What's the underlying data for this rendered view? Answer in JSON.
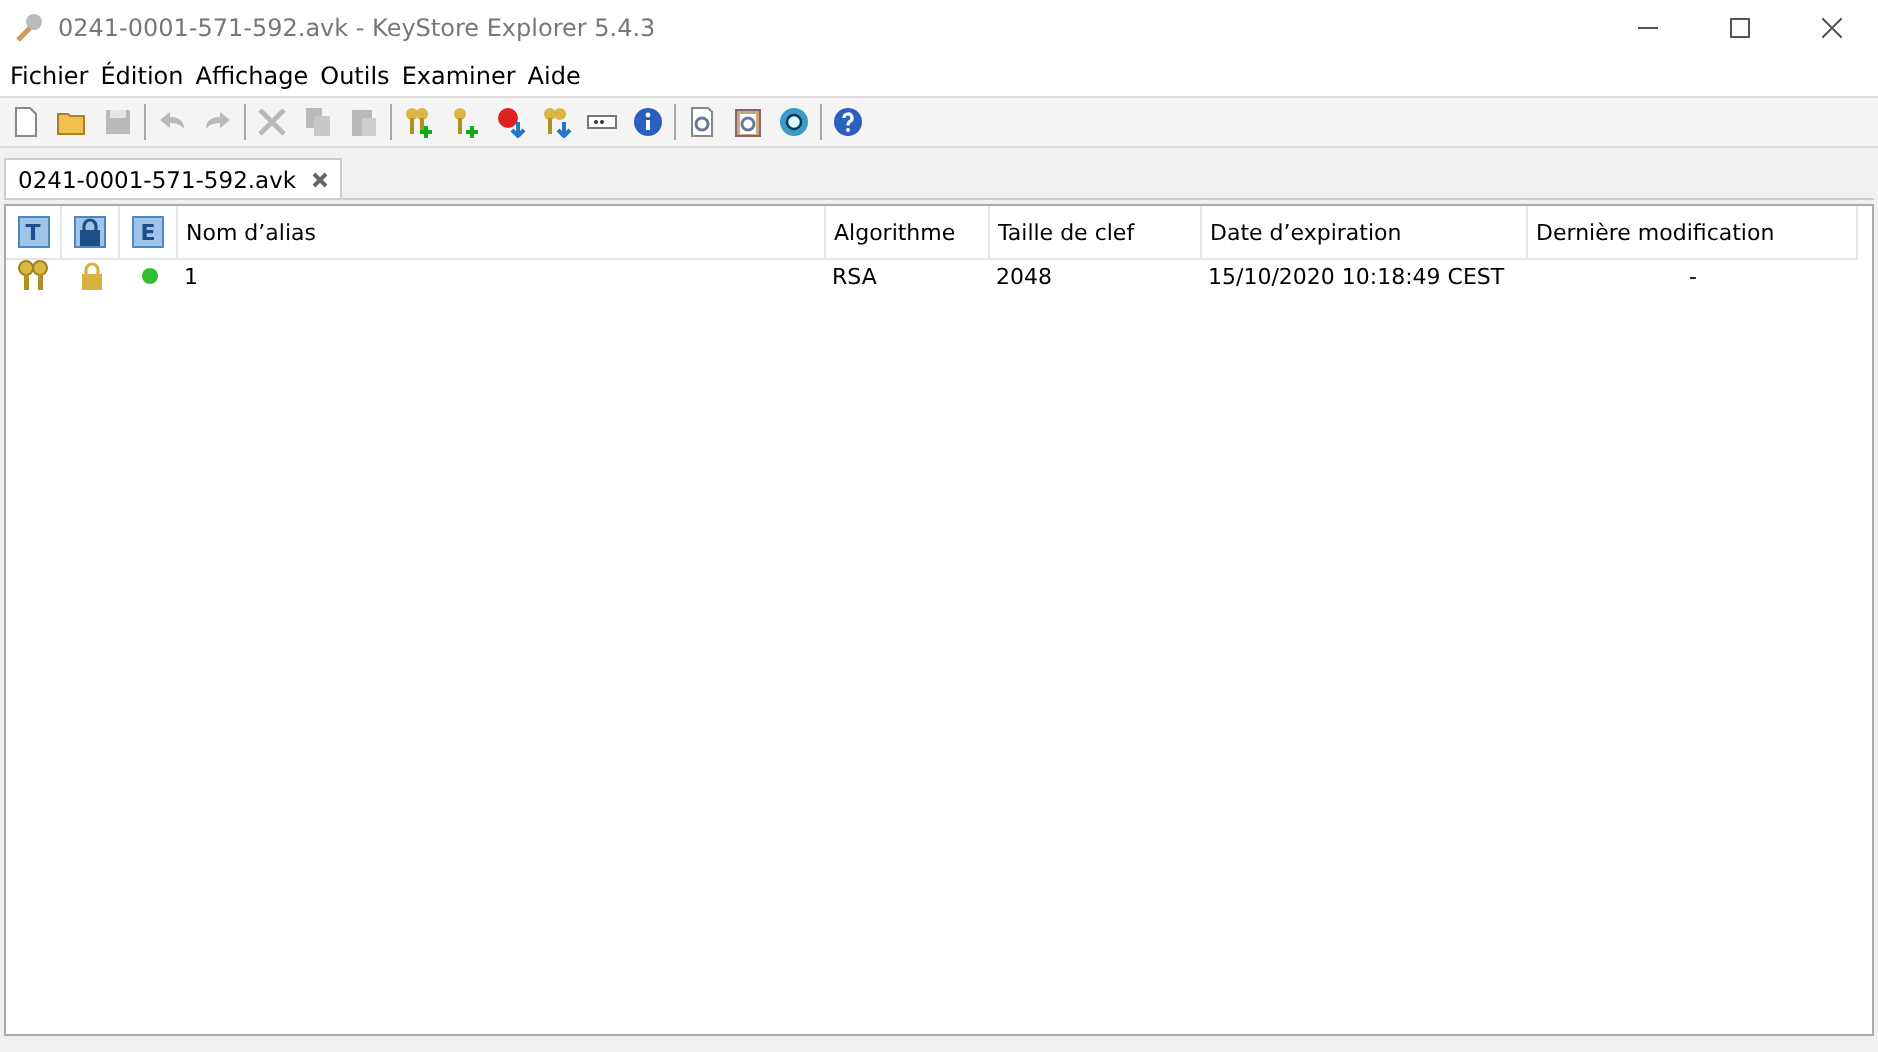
{
  "window": {
    "title": "0241-0001-571-592.avk - KeyStore Explorer 5.4.3"
  },
  "menu": [
    "Fichier",
    "Édition",
    "Affichage",
    "Outils",
    "Examiner",
    "Aide"
  ],
  "toolbar": [
    {
      "kind": "new",
      "disabled": false
    },
    {
      "kind": "open",
      "disabled": false
    },
    {
      "kind": "save",
      "disabled": true
    },
    {
      "kind": "sep"
    },
    {
      "kind": "undo",
      "disabled": true
    },
    {
      "kind": "redo",
      "disabled": true
    },
    {
      "kind": "sep"
    },
    {
      "kind": "cut",
      "disabled": true
    },
    {
      "kind": "copy",
      "disabled": true
    },
    {
      "kind": "paste",
      "disabled": true
    },
    {
      "kind": "sep"
    },
    {
      "kind": "keypair",
      "disabled": false
    },
    {
      "kind": "key",
      "disabled": false
    },
    {
      "kind": "cert",
      "disabled": false
    },
    {
      "kind": "importkeys",
      "disabled": false
    },
    {
      "kind": "password",
      "disabled": false
    },
    {
      "kind": "info",
      "disabled": false
    },
    {
      "kind": "sep"
    },
    {
      "kind": "examfile",
      "disabled": false
    },
    {
      "kind": "examclip",
      "disabled": false
    },
    {
      "kind": "examssl",
      "disabled": false
    },
    {
      "kind": "sep"
    },
    {
      "kind": "help",
      "disabled": false
    }
  ],
  "tabs": [
    {
      "label": "0241-0001-571-592.avk",
      "selected": true
    }
  ],
  "table": {
    "icon_headers": [
      {
        "kind": "letter",
        "text": "T"
      },
      {
        "kind": "lock"
      },
      {
        "kind": "letter",
        "text": "E"
      }
    ],
    "columns": [
      "Nom d’alias",
      "Algorithme",
      "Taille de clef",
      "Date d’expiration",
      "Dernière modification"
    ],
    "rows": [
      {
        "kind": "keypair",
        "locked": true,
        "color": "#2fbf2f",
        "cells": [
          "1",
          "RSA",
          "2048",
          "15/10/2020 10:18:49 CEST",
          "-"
        ]
      }
    ]
  }
}
